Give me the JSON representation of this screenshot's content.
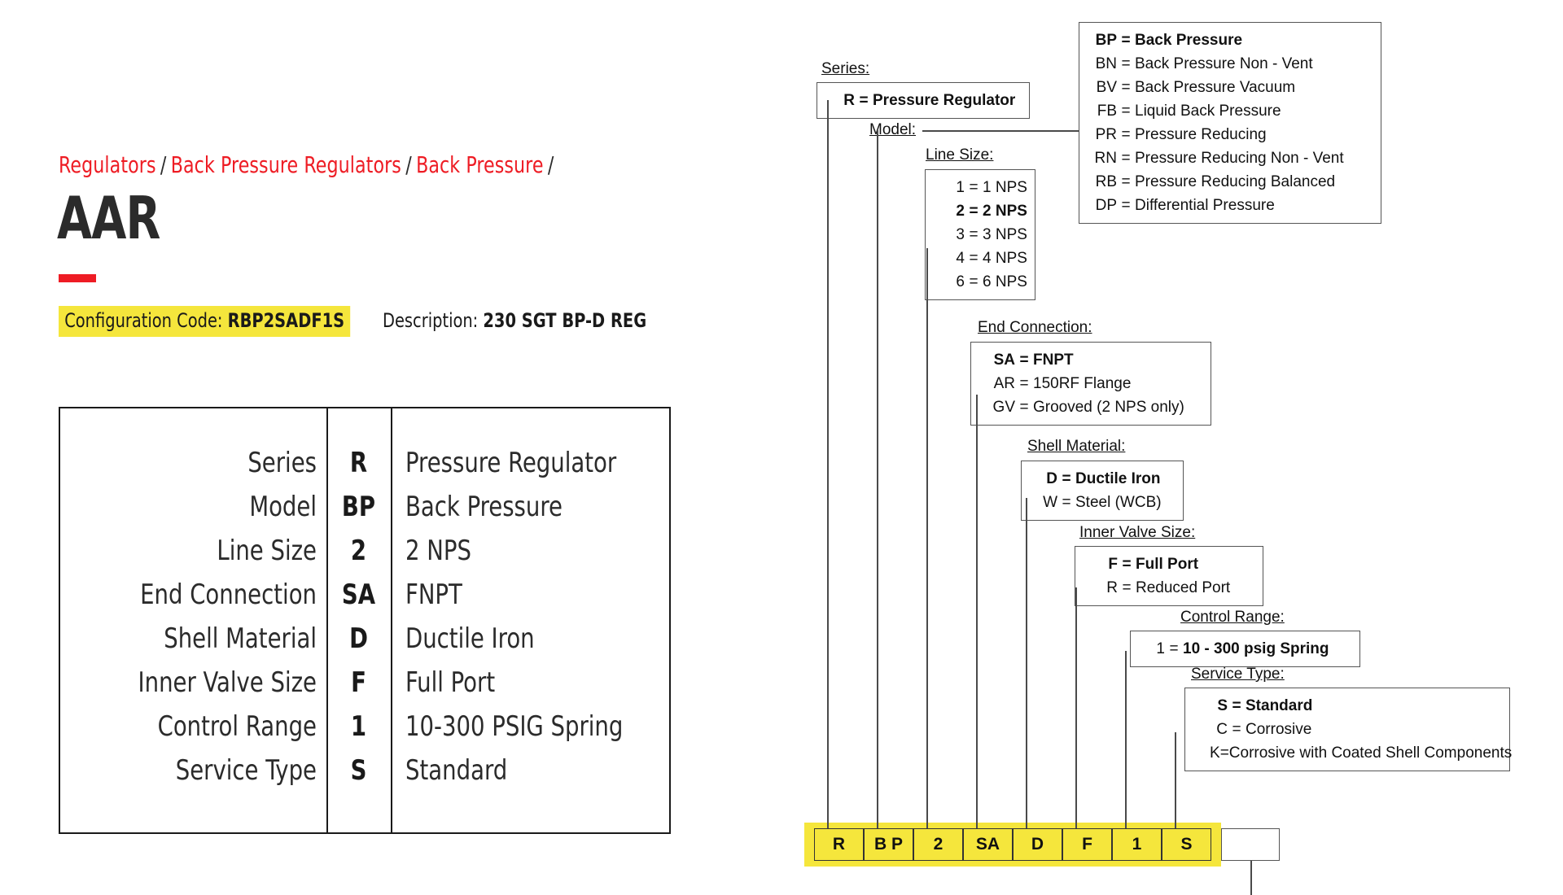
{
  "breadcrumb": {
    "items": [
      "Regulators",
      "Back Pressure Regulators",
      "Back Pressure"
    ],
    "separator": "/",
    "trailing_separator": "/"
  },
  "page_title": "AAR",
  "config": {
    "code_label": "Configuration Code:",
    "code_value": "RBP2SADF1S",
    "description_label": "Description:",
    "description_value": "230 SGT BP-D REG",
    "highlight_color": "#f5e63c",
    "accent_color": "#ee1c24"
  },
  "spec_table": {
    "rows": [
      {
        "label": "Series",
        "code": "R",
        "value": "Pressure Regulator"
      },
      {
        "label": "Model",
        "code": "BP",
        "value": "Back Pressure"
      },
      {
        "label": "Line Size",
        "code": "2",
        "value": "2 NPS"
      },
      {
        "label": "End Connection",
        "code": "SA",
        "value": "FNPT"
      },
      {
        "label": "Shell Material",
        "code": "D",
        "value": "Ductile Iron"
      },
      {
        "label": "Inner Valve Size",
        "code": "F",
        "value": "Full Port"
      },
      {
        "label": "Control Range",
        "code": "1",
        "value": "10-300 PSIG Spring"
      },
      {
        "label": "Service Type",
        "code": "S",
        "value": "Standard"
      }
    ]
  },
  "diagram": {
    "groups": {
      "series": {
        "label": "Series:",
        "options": [
          {
            "k": "R",
            "d": "Pressure Regulator",
            "selected": true
          }
        ]
      },
      "model": {
        "label": "Model:",
        "options": [
          {
            "k": "BP",
            "d": "Back Pressure",
            "selected": true
          },
          {
            "k": "BN",
            "d": "Back Pressure Non - Vent",
            "selected": false
          },
          {
            "k": "BV",
            "d": "Back Pressure Vacuum",
            "selected": false
          },
          {
            "k": "FB",
            "d": "Liquid Back Pressure",
            "selected": false
          },
          {
            "k": "PR",
            "d": "Pressure Reducing",
            "selected": false
          },
          {
            "k": "RN",
            "d": "Pressure Reducing Non - Vent",
            "selected": false
          },
          {
            "k": "RB",
            "d": "Pressure Reducing Balanced",
            "selected": false
          },
          {
            "k": "DP",
            "d": "Differential Pressure",
            "selected": false
          }
        ]
      },
      "line_size": {
        "label": "Line Size:",
        "options": [
          {
            "k": "1",
            "d": "1 NPS",
            "selected": false
          },
          {
            "k": "2",
            "d": "2 NPS",
            "selected": true
          },
          {
            "k": "3",
            "d": "3 NPS",
            "selected": false
          },
          {
            "k": "4",
            "d": "4 NPS",
            "selected": false
          },
          {
            "k": "6",
            "d": "6 NPS",
            "selected": false
          }
        ]
      },
      "end_connection": {
        "label": "End Connection:",
        "options": [
          {
            "k": "SA",
            "d": "FNPT",
            "selected": true
          },
          {
            "k": "AR",
            "d": "150RF Flange",
            "selected": false
          },
          {
            "k": "GV",
            "d": "Grooved (2 NPS only)",
            "selected": false
          }
        ]
      },
      "shell_material": {
        "label": "Shell Material:",
        "options": [
          {
            "k": "D",
            "d": "Ductile Iron",
            "selected": true
          },
          {
            "k": "W",
            "d": "Steel (WCB)",
            "selected": false
          }
        ]
      },
      "inner_valve": {
        "label": "Inner Valve Size:",
        "options": [
          {
            "k": "F",
            "d": "Full Port",
            "selected": true
          },
          {
            "k": "R",
            "d": "Reduced Port",
            "selected": false
          }
        ]
      },
      "control_range": {
        "label": "Control Range:",
        "options": [
          {
            "k": "1",
            "d": "10 - 300 psig Spring",
            "selected": false,
            "value_bold": true
          }
        ]
      },
      "service_type": {
        "label": "Service Type:",
        "options": [
          {
            "k": "S",
            "d": "Standard",
            "selected": true
          },
          {
            "k": "C",
            "d": "Corrosive",
            "selected": false
          },
          {
            "k": "K",
            "d": "Corrosive with Coated Shell Components",
            "selected": false
          }
        ]
      }
    },
    "code_bar": {
      "cells": [
        "R",
        "B P",
        "2",
        "SA",
        "D",
        "F",
        "1",
        "S"
      ],
      "trailing_empty_cell": ""
    }
  }
}
